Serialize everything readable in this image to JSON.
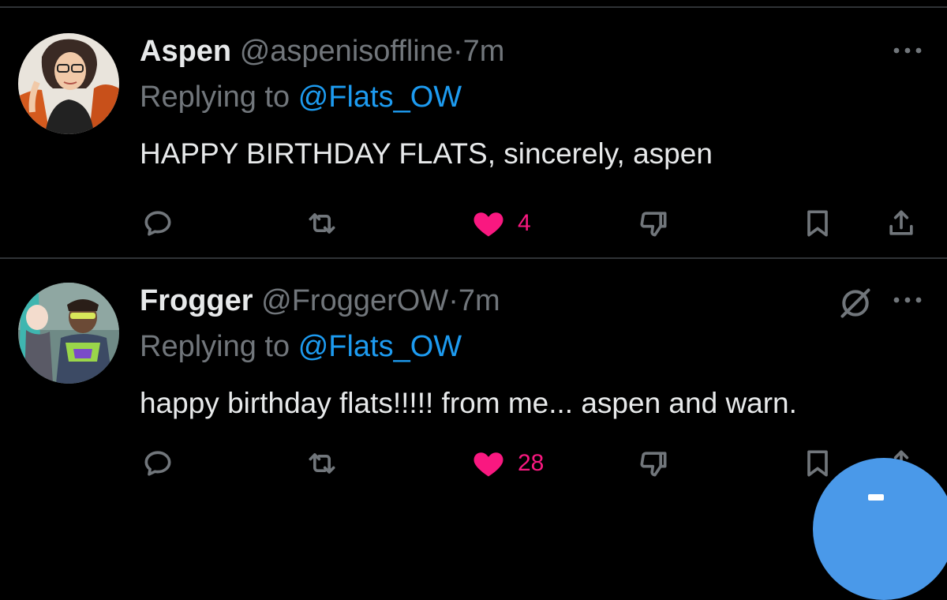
{
  "tweets": [
    {
      "author_name": "Aspen",
      "handle": "@aspenisoffline",
      "separator": "·",
      "time": "7m",
      "replying_prefix": "Replying to",
      "replying_mention": "@Flats_OW",
      "text": "HAPPY BIRTHDAY FLATS, sincerely, aspen",
      "like_count": "4",
      "liked": true,
      "icons": [
        "reply-icon",
        "retweet-icon",
        "heart-icon",
        "downvote-icon",
        "bookmark-icon",
        "share-icon"
      ]
    },
    {
      "author_name": "Frogger",
      "handle": "@FroggerOW",
      "separator": "·",
      "time": "7m",
      "replying_prefix": "Replying to",
      "replying_mention": "@Flats_OW",
      "text": "happy birthday flats!!!!! from me... aspen and warn.",
      "like_count": "28",
      "liked": true,
      "icons": [
        "reply-icon",
        "retweet-icon",
        "heart-icon",
        "downvote-icon",
        "bookmark-icon",
        "share-icon",
        "grok-icon"
      ]
    }
  ],
  "colors": {
    "background": "#000000",
    "text_primary": "#e7e9ea",
    "text_secondary": "#71767b",
    "mention": "#1d9bf0",
    "like": "#f91880",
    "fab": "#4a99e9",
    "divider": "#2f3336"
  },
  "fab_icon": "plus-icon"
}
